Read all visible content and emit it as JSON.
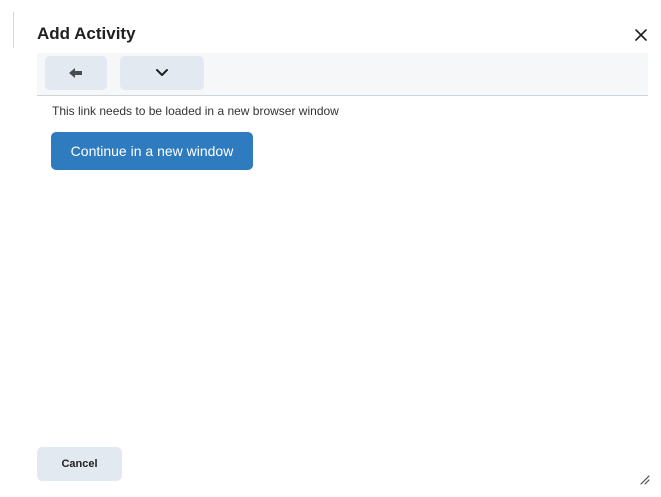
{
  "dialog": {
    "title": "Add Activity",
    "close_icon": "close-icon"
  },
  "toolbar": {
    "back_icon": "arrow-left-icon",
    "dropdown_icon": "chevron-down-icon"
  },
  "content": {
    "message": "This link needs to be loaded in a new browser window",
    "continue_label": "Continue in a new window"
  },
  "footer": {
    "cancel_label": "Cancel",
    "resize_icon": "resize-handle-icon"
  },
  "colors": {
    "primary": "#2f7bbf",
    "secondary_button": "#e3e9f1",
    "toolbar_bg": "#f6f7f8",
    "text": "#202122"
  }
}
